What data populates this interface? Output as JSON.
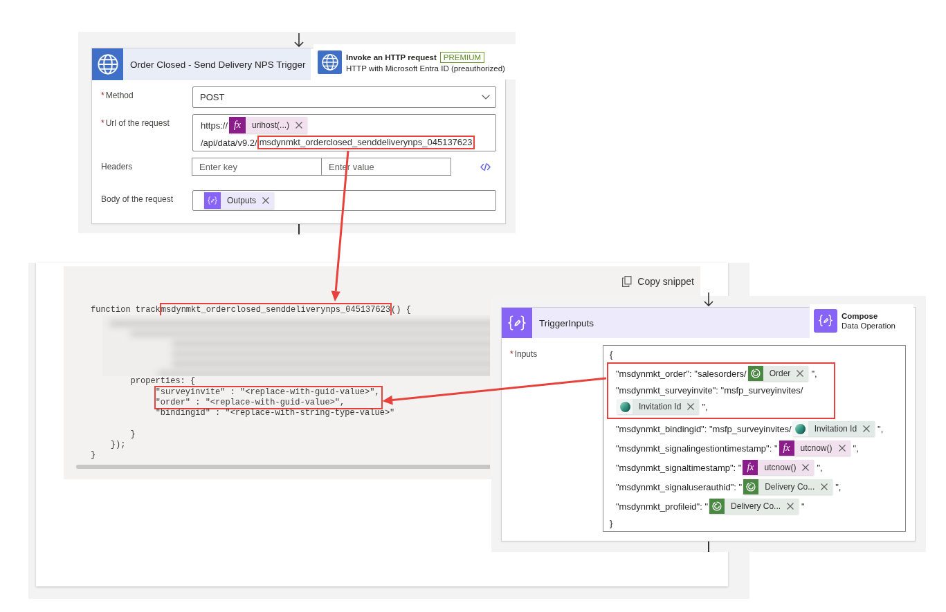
{
  "trigger_step": {
    "title": "Order Closed - Send Delivery NPS Trigger",
    "action": {
      "name": "Invoke an HTTP request",
      "badge": "PREMIUM",
      "connector": "HTTP with Microsoft Entra ID (preauthorized)"
    },
    "fields": [
      {
        "kind": "dropdown",
        "required_mark": "*",
        "label": "Method",
        "value": "POST"
      },
      {
        "kind": "expression",
        "required_mark": "*",
        "label": "Url of the request",
        "lines": [
          [
            {
              "kind": "text",
              "text": "https://",
              "highlighted": false
            },
            {
              "kind": "function",
              "icon": "fx",
              "text": "urihost(...)",
              "highlighted": false
            }
          ],
          [
            {
              "kind": "text",
              "text": "/api/data/v9.2/",
              "highlighted": false
            },
            {
              "kind": "text",
              "text": "msdynmkt_orderclosed_senddeliverynps_045137623",
              "highlighted": true
            }
          ]
        ]
      },
      {
        "kind": "key_value",
        "label": "Headers",
        "key_placeholder": "Enter key",
        "value_placeholder": "Enter value"
      },
      {
        "kind": "expression",
        "label": "Body of the request",
        "lines": [
          [
            {
              "kind": "compose",
              "text": "Outputs",
              "highlighted": false
            }
          ]
        ]
      }
    ]
  },
  "snippet": {
    "copy_button": "Copy snippet",
    "lines": [
      {
        "kind": "code",
        "highlighted": false,
        "parts": [
          {
            "text": "function track",
            "highlighted": false
          },
          {
            "text": "msdynmkt_orderclosed_senddeliverynps_045137623",
            "highlighted": true
          },
          {
            "text": "() {",
            "highlighted": false
          }
        ]
      },
      {
        "kind": "blurred",
        "highlighted": false
      },
      {
        "kind": "code",
        "highlighted": false,
        "parts": [
          {
            "text": "        properties: {",
            "highlighted": false
          }
        ]
      },
      {
        "kind": "code",
        "highlighted": true,
        "parts": [
          {
            "text": "             \"surveyinvite\" : \"<replace-with-guid-value>\",",
            "highlighted": false
          }
        ]
      },
      {
        "kind": "code",
        "highlighted": true,
        "parts": [
          {
            "text": "             \"order\" : \"<replace-with-guid-value>\",",
            "highlighted": false
          }
        ]
      },
      {
        "kind": "code",
        "highlighted": false,
        "parts": [
          {
            "text": "             \"bindingid\" : \"<replace-with-string-type-value>\"",
            "highlighted": false
          }
        ]
      },
      {
        "kind": "blank",
        "highlighted": false
      },
      {
        "kind": "code",
        "highlighted": false,
        "parts": [
          {
            "text": "        }",
            "highlighted": false
          }
        ]
      },
      {
        "kind": "code",
        "highlighted": false,
        "parts": [
          {
            "text": "    });",
            "highlighted": false
          }
        ]
      },
      {
        "kind": "code",
        "highlighted": false,
        "parts": [
          {
            "text": "}",
            "highlighted": false
          }
        ]
      }
    ]
  },
  "compose_step": {
    "title": "TriggerInputs",
    "action": {
      "name": "Compose",
      "connector": "Data Operation"
    },
    "inputs": {
      "required_mark": "*",
      "label": "Inputs",
      "lines": [
        {
          "kind": "brace",
          "highlighted": false,
          "parts": [
            {
              "kind": "text",
              "text": "{"
            }
          ]
        },
        {
          "kind": "entry",
          "highlighted": true,
          "parts": [
            {
              "kind": "text",
              "text": "\"msdynmkt_order\": \"salesorders/"
            },
            {
              "kind": "dataverse",
              "text": "Order"
            },
            {
              "kind": "text",
              "text": "\","
            }
          ]
        },
        {
          "kind": "entry",
          "highlighted": true,
          "parts": [
            {
              "kind": "text",
              "text": "\"msdynmkt_surveyinvite\": \"msfp_surveyinvites/"
            }
          ]
        },
        {
          "kind": "entry",
          "highlighted": true,
          "parts": [
            {
              "kind": "forms",
              "text": "Invitation Id"
            },
            {
              "kind": "text",
              "text": "\","
            }
          ]
        },
        {
          "kind": "entry",
          "highlighted": false,
          "parts": [
            {
              "kind": "text",
              "text": "\"msdynmkt_bindingid\": \"msfp_surveyinvites/"
            },
            {
              "kind": "forms",
              "text": "Invitation Id"
            },
            {
              "kind": "text",
              "text": "\","
            }
          ]
        },
        {
          "kind": "entry",
          "highlighted": false,
          "parts": [
            {
              "kind": "text",
              "text": "\"msdynmkt_signalingestiontimestamp\": \""
            },
            {
              "kind": "function",
              "icon": "fx",
              "text": "utcnow()"
            },
            {
              "kind": "text",
              "text": "\","
            }
          ]
        },
        {
          "kind": "entry",
          "highlighted": false,
          "parts": [
            {
              "kind": "text",
              "text": "\"msdynmkt_signaltimestamp\": \""
            },
            {
              "kind": "function",
              "icon": "fx",
              "text": "utcnow()"
            },
            {
              "kind": "text",
              "text": "\","
            }
          ]
        },
        {
          "kind": "entry",
          "highlighted": false,
          "parts": [
            {
              "kind": "text",
              "text": "\"msdynmkt_signaluserauthid\": \""
            },
            {
              "kind": "dataverse",
              "text": "Delivery Co..."
            },
            {
              "kind": "text",
              "text": "\","
            }
          ]
        },
        {
          "kind": "entry",
          "highlighted": false,
          "parts": [
            {
              "kind": "text",
              "text": "\"msdynmkt_profileid\": \""
            },
            {
              "kind": "dataverse",
              "text": "Delivery Co..."
            },
            {
              "kind": "text",
              "text": "\""
            }
          ]
        },
        {
          "kind": "brace",
          "highlighted": false,
          "parts": [
            {
              "kind": "text",
              "text": "}"
            }
          ]
        }
      ]
    }
  }
}
